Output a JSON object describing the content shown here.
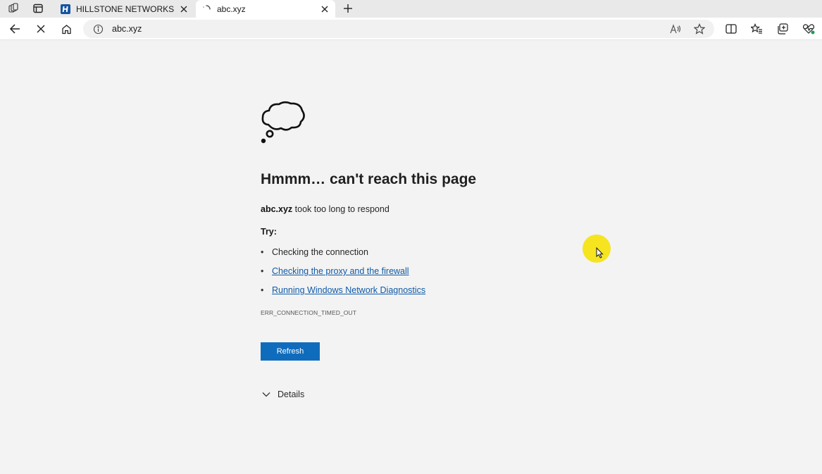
{
  "browser": {
    "tabs": [
      {
        "title": "HILLSTONE NETWORKS",
        "favicon": "hillstone-logo",
        "active": false
      },
      {
        "title": "abc.xyz",
        "favicon": "loading-spinner",
        "active": true
      }
    ],
    "address": {
      "url": "abc.xyz"
    },
    "colors": {
      "accent": "#0f6cbd",
      "link": "#0f5aa8",
      "favicon_bg": "#1554a3"
    }
  },
  "error_page": {
    "heading": "Hmmm… can't reach this page",
    "host": "abc.xyz",
    "reason": " took too long to respond",
    "try_label": "Try:",
    "suggestions": [
      {
        "text": "Checking the connection",
        "link": false
      },
      {
        "text": "Checking the proxy and the firewall",
        "link": true
      },
      {
        "text": "Running Windows Network Diagnostics",
        "link": true
      }
    ],
    "error_code": "ERR_CONNECTION_TIMED_OUT",
    "refresh_label": "Refresh",
    "details_label": "Details"
  }
}
